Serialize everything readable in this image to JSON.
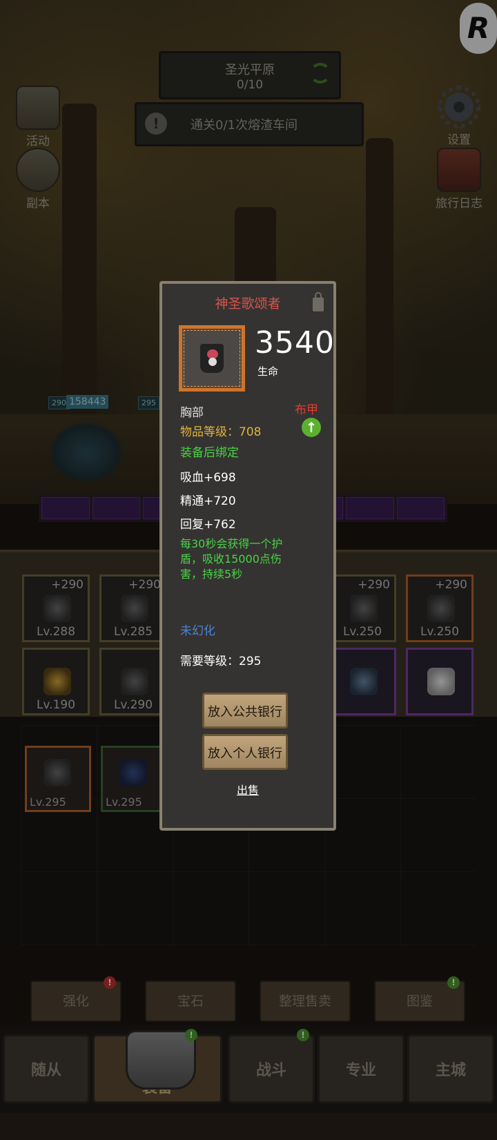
{
  "zone": {
    "name": "圣光平原",
    "progress": "0/10"
  },
  "quest": {
    "text": "通关0/1次熔渣车间"
  },
  "side_buttons": {
    "events": "活动",
    "dungeon": "副本",
    "settings": "设置",
    "journal": "旅行日志"
  },
  "hero": {
    "level_1": "290",
    "level_2": "295",
    "hp": "158443"
  },
  "equipment": [
    {
      "plus": "+290",
      "lv": "Lv.288"
    },
    {
      "plus": "+290",
      "lv": "Lv.285"
    },
    {
      "plus": "+290",
      "lv": "Lv.250"
    },
    {
      "plus": "+290",
      "lv": "Lv.250"
    },
    {
      "lv": "Lv.190"
    },
    {
      "lv": "Lv.290"
    }
  ],
  "bag": [
    {
      "lv": "Lv.295"
    },
    {
      "lv": "Lv.295"
    }
  ],
  "toolbar": {
    "enhance": "强化",
    "gems": "宝石",
    "sort_sell": "整理售卖",
    "codex": "图鉴",
    "enhance_badge": "!",
    "codex_badge": "!"
  },
  "nav": {
    "followers": "随从",
    "equipment": "装备",
    "battle": "战斗",
    "profession": "专业",
    "city": "主城",
    "equipment_badge": "!",
    "battle_badge": "!"
  },
  "tooltip": {
    "title": "神圣歌颂者",
    "main_value": "3540",
    "main_stat": "生命",
    "slot": "胸部",
    "armor_type": "布甲",
    "item_level": "物品等级：708",
    "bind": "装备后绑定",
    "stat1": "吸血+698",
    "stat2": "精通+720",
    "stat3": "回复+762",
    "effect": "每30秒会获得一个护盾，吸收15000点伤害，持续5秒",
    "transmog": "未幻化",
    "required_level": "需要等级：295",
    "btn_public_bank": "放入公共银行",
    "btn_personal_bank": "放入个人银行",
    "sell": "出售"
  },
  "colors": {
    "title_red": "#d9534b",
    "item_level_gold": "#e2b23e",
    "bind_green": "#4bd246",
    "transmog_blue": "#4b84d6",
    "frame_orange": "#d1732a"
  }
}
